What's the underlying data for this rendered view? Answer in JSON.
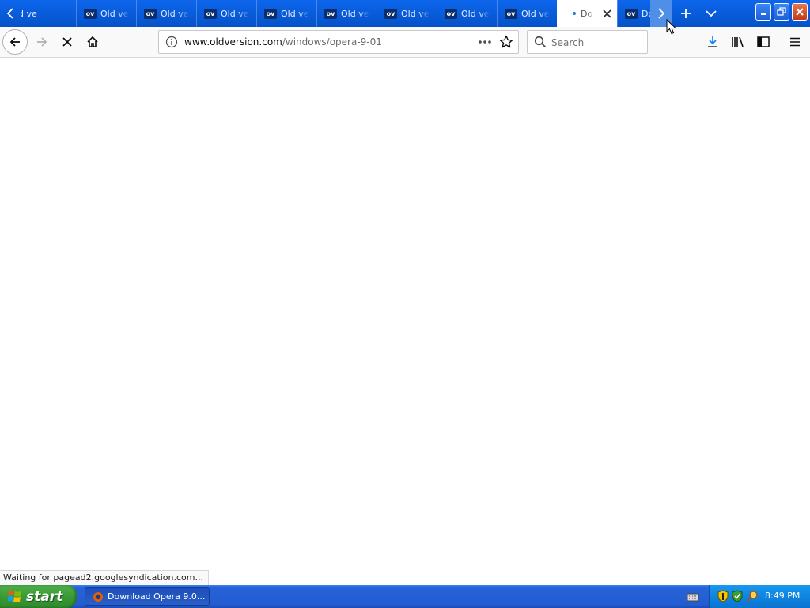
{
  "browser": {
    "tabs": [
      {
        "favicon": "",
        "label": "d ve",
        "active": false
      },
      {
        "favicon": "ov",
        "label": "Old ve",
        "active": false
      },
      {
        "favicon": "ov",
        "label": "Old ve",
        "active": false
      },
      {
        "favicon": "ov",
        "label": "Old ve",
        "active": false
      },
      {
        "favicon": "ov",
        "label": "Old ve",
        "active": false
      },
      {
        "favicon": "ov",
        "label": "Old ve",
        "active": false
      },
      {
        "favicon": "ov",
        "label": "Old ve",
        "active": false
      },
      {
        "favicon": "ov",
        "label": "Old ve",
        "active": false
      },
      {
        "favicon": "ov",
        "label": "Old ve",
        "active": false
      },
      {
        "favicon": "",
        "label": "Do",
        "active": true
      },
      {
        "favicon": "ov",
        "label": "Downl",
        "active": false
      }
    ],
    "url": {
      "host": "www.oldversion.com",
      "path": "/windows/opera-9-01"
    },
    "search": {
      "placeholder": "Search",
      "value": ""
    },
    "status": "Waiting for pagead2.googlesyndication.com...",
    "loading": true
  },
  "taskbar": {
    "start_label": "start",
    "task_item_label": "Download Opera 9.0...",
    "clock": "8:49 PM"
  },
  "colors": {
    "tabbar": "#0552c9",
    "accent": "#2b7ddb",
    "start_green": "#3a9a35",
    "taskbar_blue": "#245dd2",
    "close_red": "#c2391a"
  },
  "icons": [
    "chevron-left-icon",
    "chevron-right-icon",
    "plus-icon",
    "chevron-down-icon",
    "minimize-icon",
    "restore-icon",
    "close-icon",
    "back-arrow-icon",
    "forward-arrow-icon",
    "stop-icon",
    "home-icon",
    "info-icon",
    "more-dots-icon",
    "star-icon",
    "search-icon",
    "download-icon",
    "library-icon",
    "sidebar-icon",
    "hamburger-menu-icon",
    "windows-logo-icon",
    "keyboard-icon",
    "shield-icon",
    "network-icon",
    "magnifier-icon"
  ]
}
